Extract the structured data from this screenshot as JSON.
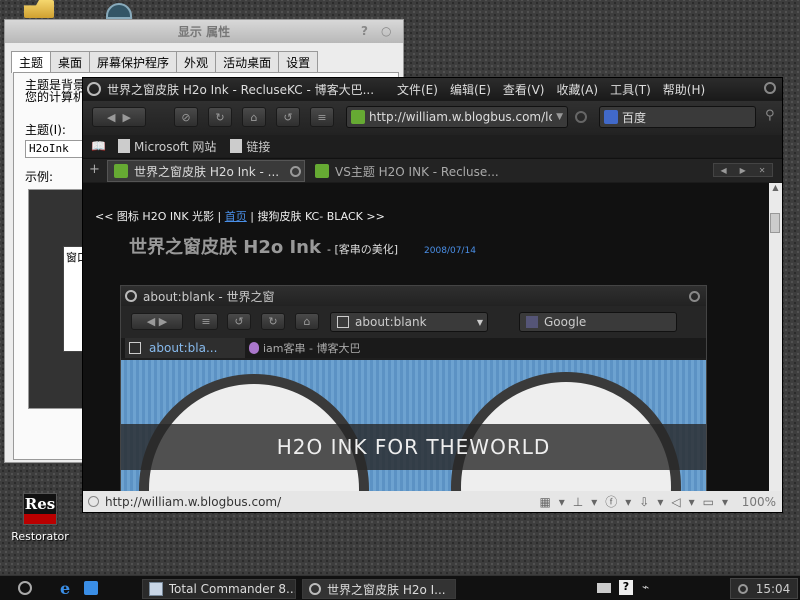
{
  "desktop": {
    "restorator_label": "Restorator"
  },
  "dialog": {
    "title": "显示 属性",
    "help_glyph": "?",
    "close_glyph": "○",
    "tabs": [
      "主题",
      "桌面",
      "屏幕保护程序",
      "外观",
      "活动桌面",
      "设置"
    ],
    "description_line1": "主题是背景",
    "description_line2": "您的计算机",
    "theme_label": "主题(I):",
    "theme_value": "H2oInk",
    "example_label": "示例:",
    "preview_window_text": "窗口"
  },
  "browser": {
    "title": "世界之窗皮肤 H2o Ink - RecluseKC - 博客大巴...",
    "menu": [
      "文件(E)",
      "编辑(E)",
      "查看(V)",
      "收藏(A)",
      "工具(T)",
      "帮助(H)"
    ],
    "address": "http://william.w.blogbus.com/lo",
    "search_engine": "百度",
    "bookmarks": [
      "Microsoft 网站",
      "链接"
    ],
    "tabs": [
      {
        "label": "世界之窗皮肤 H2o Ink - ..."
      },
      {
        "label": "VS主题 H2O INK - Recluse..."
      }
    ],
    "page": {
      "nav_prefix": "<< 图标 H2O INK 光影 |",
      "nav_link": "首页",
      "nav_suffix": "| 搜狗皮肤 KC- BLACK >>",
      "post_title": "世界之窗皮肤 H2o Ink",
      "post_category": "- [客串の美化]",
      "post_date": "2008/07/14"
    },
    "inner": {
      "title": "about:blank - 世界之窗",
      "address": "about:blank",
      "search_engine": "Google",
      "tabs": [
        {
          "label": "about:bla..."
        },
        {
          "label": "iam客串 - 博客大巴"
        }
      ],
      "banner_text": "H2O INK  FOR  THEWORLD"
    },
    "status_url": "http://william.w.blogbus.com/",
    "zoom": "100%"
  },
  "taskbar": {
    "tasks": [
      "Total Commander 8...",
      "世界之窗皮肤 H2o I..."
    ],
    "clock": "15:04"
  }
}
